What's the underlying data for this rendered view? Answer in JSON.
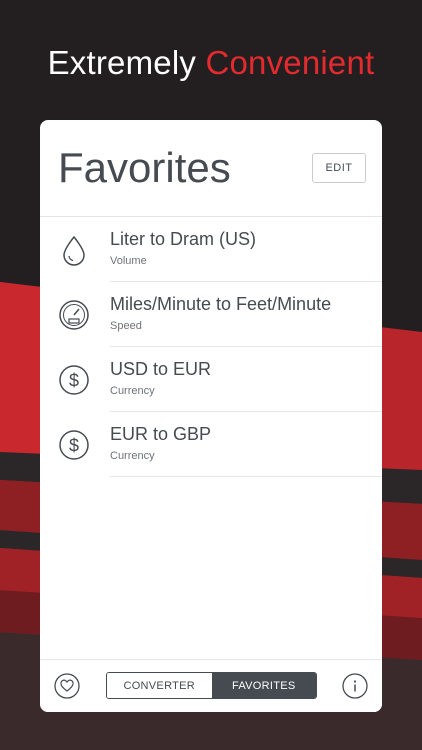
{
  "headline": {
    "text_plain": "Extremely",
    "text_accent": "Convenient"
  },
  "colors": {
    "accent": "#e32a2f",
    "dark": "#231f20",
    "text": "#454b51"
  },
  "card": {
    "title": "Favorites",
    "edit_label": "EDIT",
    "items": [
      {
        "name": "Liter to Dram (US)",
        "category": "Volume",
        "icon": "drop-icon"
      },
      {
        "name": "Miles/Minute to Feet/Minute",
        "category": "Speed",
        "icon": "speedometer-icon"
      },
      {
        "name": "USD to EUR",
        "category": "Currency",
        "icon": "dollar-icon"
      },
      {
        "name": "EUR to GBP",
        "category": "Currency",
        "icon": "dollar-icon"
      }
    ]
  },
  "footer": {
    "tabs": [
      {
        "label": "CONVERTER",
        "active": false
      },
      {
        "label": "FAVORITES",
        "active": true
      }
    ],
    "left_icon": "heart-icon",
    "right_icon": "info-icon"
  }
}
